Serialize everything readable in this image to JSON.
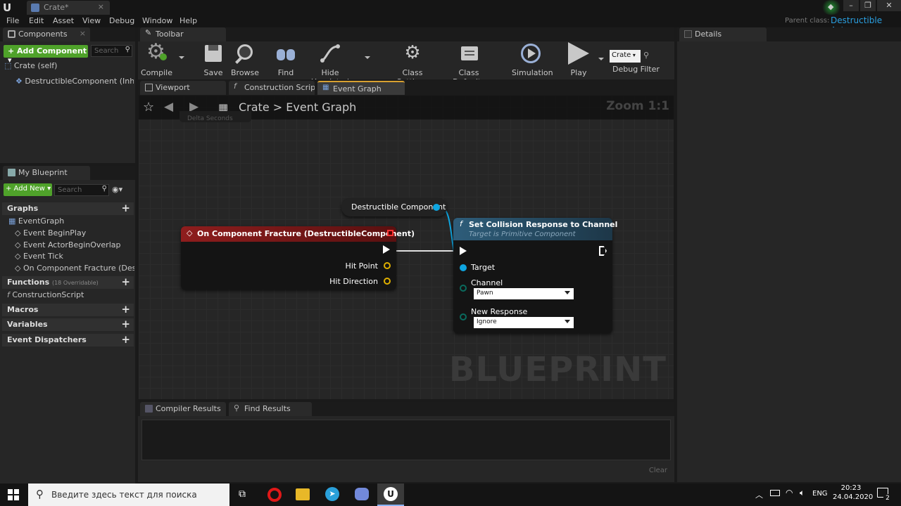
{
  "titlebar": {
    "tab_title": "Crate*"
  },
  "menu": [
    "File",
    "Edit",
    "Asset",
    "View",
    "Debug",
    "Window",
    "Help"
  ],
  "parent_class": {
    "label": "Parent class:",
    "value": "Destructible Actor"
  },
  "components_panel": {
    "tab": "Components",
    "add_button": "+ Add Component ▾",
    "search_placeholder": "Search",
    "items": [
      "Crate (self)",
      "DestructibleComponent (Inherited)"
    ]
  },
  "my_blueprint_panel": {
    "tab": "My Blueprint",
    "add_button": "+ Add New ▾",
    "search_placeholder": "Search",
    "graphs_label": "Graphs",
    "graph_root": "EventGraph",
    "events": [
      "Event BeginPlay",
      "Event ActorBeginOverlap",
      "Event Tick",
      "On Component Fracture (Destr"
    ],
    "functions_label": "Functions",
    "functions_overridable": "(18 Overridable)",
    "function_item": "ConstructionScript",
    "macros_label": "Macros",
    "variables_label": "Variables",
    "dispatchers_label": "Event Dispatchers"
  },
  "toolbar": {
    "tab": "Toolbar",
    "buttons": [
      "Compile",
      "Save",
      "Browse",
      "Find",
      "Hide Unrelated",
      "Class Settings",
      "Class Defaults",
      "Simulation",
      "Play"
    ],
    "debug_object": "Crate",
    "debug_filter_label": "Debug Filter"
  },
  "editor_tabs": [
    "Viewport",
    "Construction Script",
    "Event Graph"
  ],
  "graph": {
    "breadcrumb_root": "Crate",
    "breadcrumb_sep": ">",
    "breadcrumb_current": "Event Graph",
    "zoom": "Zoom 1:1",
    "watermark": "BLUEPRINT",
    "ghost_label": "Delta Seconds",
    "component_node": "Destructible Component",
    "event_node": {
      "title": "On Component Fracture (DestructibleComponent)",
      "pin_hit_point": "Hit Point",
      "pin_hit_direction": "Hit Direction"
    },
    "func_node": {
      "title": "Set Collision Response to Channel",
      "subtitle": "Target is Primitive Component",
      "pin_target": "Target",
      "channel_label": "Channel",
      "channel_value": "Pawn",
      "response_label": "New Response",
      "response_value": "Ignore"
    }
  },
  "bottom_panel": {
    "tabs": [
      "Compiler Results",
      "Find Results"
    ],
    "clear_button": "Clear"
  },
  "details_panel": {
    "tab": "Details"
  },
  "taskbar": {
    "search_placeholder": "Введите здесь текст для поиска",
    "language": "ENG",
    "time": "20:23",
    "date": "24.04.2020",
    "notification_count": "2"
  },
  "colors": {
    "accent_blue": "#2a9fe0",
    "event_red": "#8e1d1d",
    "func_blue": "#2e5d7a",
    "add_green": "#4fa22a"
  }
}
